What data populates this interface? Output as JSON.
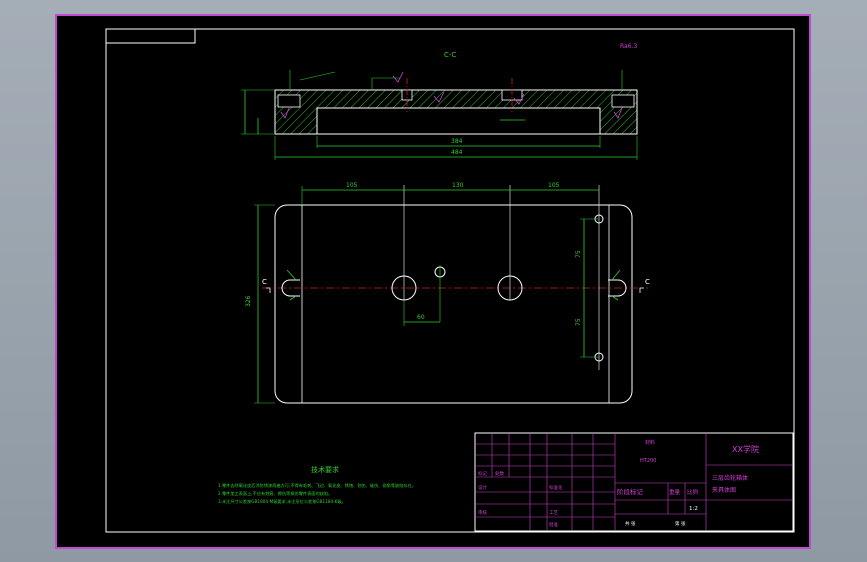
{
  "drawing": {
    "section_label": "C-C",
    "section_marker": "C",
    "roughness_note": "Ra6.3",
    "dims_section": {
      "inner_width": "384",
      "outer_width": "484"
    },
    "dims_plan": {
      "left_spacing": "105",
      "middle_spacing": "130",
      "right_spacing": "105",
      "height": "326",
      "upper_vertical": "75",
      "lower_vertical": "75",
      "hole_offset": "60"
    }
  },
  "tech_requirements": {
    "title": "技术要求",
    "lines": [
      "1.零件去除氧化皮后涂防锈漆两遍方可,不得有毛刺、飞边、氧化皮、锈蚀、划伤、碰伤、锐角等缺陷存在。",
      "2.零件加工表面上,不应有划痕、擦伤等损伤零件表面的缺陷。",
      "3.未注尺寸公差按GB1804-M级要求,未注形位公差按GB1184-K级。"
    ]
  },
  "title_block": {
    "school": "XX学院",
    "drawing_title_line1": "三层齿轮箱体",
    "drawing_title_line2": "夹具体图",
    "material_label": "材料",
    "material_value": "HT200",
    "stage_label": "阶段标记",
    "weight_label": "重量",
    "scale_label": "比例",
    "scale_value": "1:2",
    "sheet_count_label": "共 张",
    "sheet_index_label": "第 张",
    "design_label": "设计",
    "check_label": "审核",
    "process_label": "工艺",
    "mark_label": "标记",
    "count_label": "处数",
    "standard_label": "标准化",
    "approve_label": "批准"
  }
}
